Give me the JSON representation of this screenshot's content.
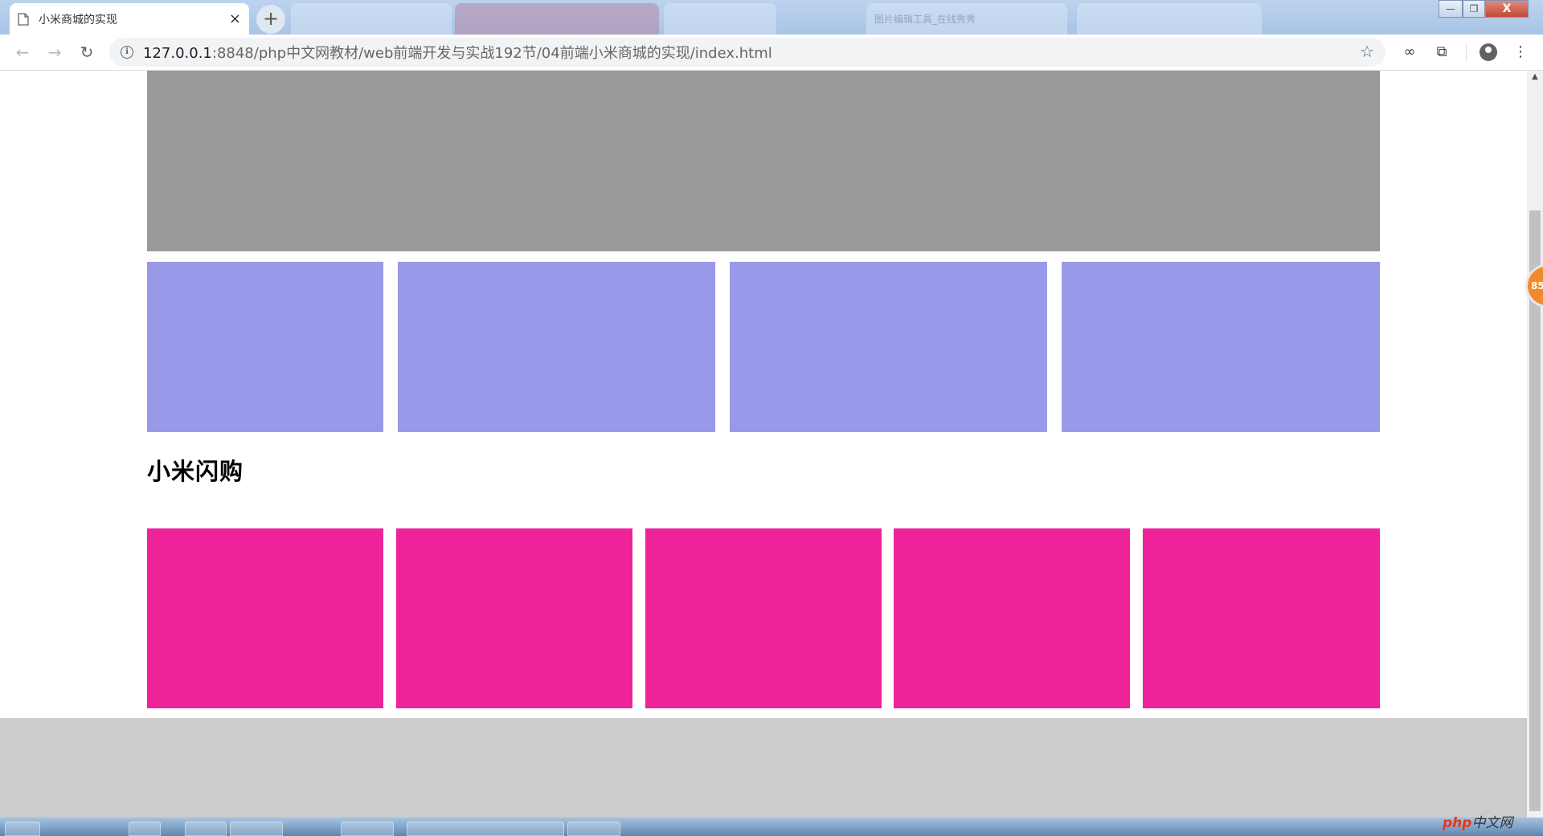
{
  "browser": {
    "active_tab": {
      "title": "小米商城的实现",
      "close": "×"
    },
    "background_tabs": [
      {
        "title": ""
      },
      {
        "title": ""
      },
      {
        "title": ""
      },
      {
        "title": "图片编辑工具_在线秀秀"
      },
      {
        "title": ""
      }
    ],
    "new_tab_label": "+",
    "window_controls": {
      "minimize": "—",
      "maximize": "❐",
      "close": "X"
    },
    "nav": {
      "back": "←",
      "forward": "→",
      "reload": "↻"
    },
    "address_bar": {
      "host": "127.0.0.1",
      "path": ":8848/php中文网教材/web前端开发与实战192节/04前端小米商城的实现/index.html"
    },
    "toolbar_icons": {
      "bookmark_star": "☆",
      "extension_1": "∞",
      "extension_2": "⧉",
      "menu": "⋮"
    }
  },
  "page": {
    "section_title": "小米闪购",
    "colors": {
      "banner": "#999999",
      "ad_tiles": "#9999ea",
      "flash_tiles": "#ee2299",
      "footer": "#cccccc"
    },
    "ad_tile_count": 4,
    "flash_tile_count": 5
  },
  "overlay": {
    "float_badge": "85",
    "watermark_brand": "php",
    "watermark_text": "中文网"
  }
}
